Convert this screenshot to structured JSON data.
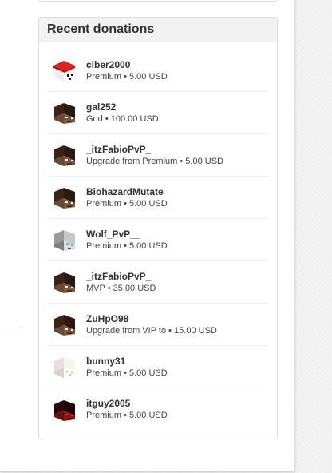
{
  "panel": {
    "title": "Recent donations"
  },
  "donations": [
    {
      "username": "ciber2000",
      "package": "Premium",
      "amount": "5.00 USD",
      "avatar": "red-hat-skin-icon"
    },
    {
      "username": "gal252",
      "package": "God",
      "amount": "100.00 USD",
      "avatar": "steve-skin-icon"
    },
    {
      "username": "_itzFabioPvP_",
      "package": "Upgrade from Premium",
      "amount": "5.00 USD",
      "avatar": "steve-skin-icon"
    },
    {
      "username": "BiohazardMutate",
      "package": "Premium",
      "amount": "5.00 USD",
      "avatar": "steve-skin-icon"
    },
    {
      "username": "Wolf_PvP__",
      "package": "Premium",
      "amount": "5.00 USD",
      "avatar": "wolf-skin-icon"
    },
    {
      "username": "_itzFabioPvP_",
      "package": "MVP",
      "amount": "35.00 USD",
      "avatar": "steve-skin-icon"
    },
    {
      "username": "ZuHpO98",
      "package": "Upgrade from VIP to",
      "amount": "15.00 USD",
      "avatar": "steve-skin-icon"
    },
    {
      "username": "bunny31",
      "package": "Premium",
      "amount": "5.00 USD",
      "avatar": "bunny-skin-icon"
    },
    {
      "username": "itguy2005",
      "package": "Premium",
      "amount": "5.00 USD",
      "avatar": "dark-red-skin-icon"
    }
  ],
  "separator": " • ",
  "colors": {
    "panel_header_bg": "#f2f2f2",
    "text": "#333333"
  }
}
